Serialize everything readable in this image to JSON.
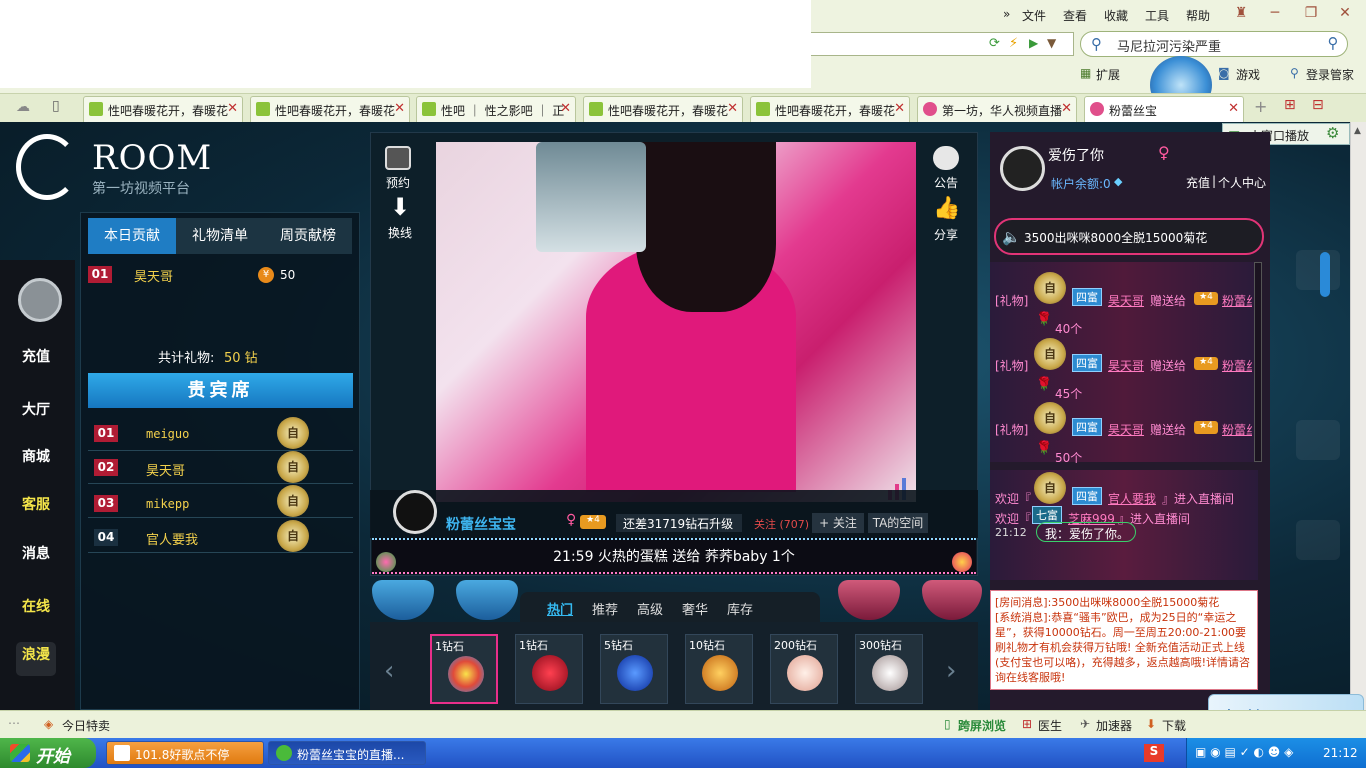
{
  "browser": {
    "menu": [
      "文件",
      "查看",
      "收藏",
      "工具",
      "帮助"
    ],
    "search_text": "马尼拉河污染严重",
    "toolbar": [
      "扩展",
      "游戏",
      "登录管家"
    ],
    "tabs": [
      {
        "label": "性吧春暖花开，春暖花"
      },
      {
        "label": "性吧春暖花开，春暖花"
      },
      {
        "label": "性吧 ｜ 性之影吧 ｜ 正"
      },
      {
        "label": "性吧春暖花开，春暖花"
      },
      {
        "label": "性吧春暖花开，春暖花"
      },
      {
        "label": "第一坊，华人视频直播"
      },
      {
        "label": "粉蕾丝宝"
      }
    ],
    "float_btn": "小窗口播放"
  },
  "site": {
    "brand": "ROOM",
    "brand_sub": "第一坊视频平台"
  },
  "leftnav": [
    "充值",
    "大厅",
    "商城",
    "客服",
    "消息",
    "在线",
    "浪漫"
  ],
  "rank": {
    "tabs": [
      "本日贡献",
      "礼物清单",
      "周贡献榜"
    ],
    "today": [
      {
        "no": "01",
        "name": "昊天哥",
        "amount": "50"
      }
    ],
    "total_label": "共计礼物:",
    "total_value": "50 钻",
    "vip_title": "贵宾席",
    "vip": [
      {
        "no": "01",
        "name": "meiguo"
      },
      {
        "no": "02",
        "name": "昊天哥"
      },
      {
        "no": "03",
        "name": "mikepp"
      },
      {
        "no": "04",
        "name": "官人要我"
      }
    ],
    "shield_label": "自"
  },
  "center": {
    "left_btns": [
      "预约",
      "换线"
    ],
    "right_btns": [
      "公告",
      "分享"
    ],
    "host_name": "粉蕾丝宝宝",
    "upgrade": "还差31719钻石升级",
    "follow_count": "关注 (707)",
    "follow_btn": "+ 关注",
    "space_btn": "TA的空间",
    "ticker": "21:59  火热的蛋糕 送给 荞荞baby  1个"
  },
  "gifts": {
    "tabs": [
      "热门",
      "推荐",
      "高级",
      "奢华",
      "库存"
    ],
    "items": [
      {
        "price": "1钻石",
        "color": "#f0a020"
      },
      {
        "price": "1钻石",
        "color": "#d01830"
      },
      {
        "price": "5钻石",
        "color": "#1f5fd8"
      },
      {
        "price": "10钻石",
        "color": "#e39a20"
      },
      {
        "price": "200钻石",
        "color": "#f4d0c0"
      },
      {
        "price": "300钻石",
        "color": "#f0e4e8"
      }
    ]
  },
  "right": {
    "user_name": "爱伤了你",
    "balance": "帐户余额:0",
    "recharge": "充值",
    "profile": "个人中心",
    "notice": "3500出咪咪8000全脱15000菊花",
    "gift_lines": [
      {
        "tag": "[礼物]",
        "level": "四富",
        "from": "昊天哥",
        "verb": "赠送给",
        "to": "粉蕾丝宝宝",
        "count": "40个"
      },
      {
        "tag": "[礼物]",
        "level": "四富",
        "from": "昊天哥",
        "verb": "赠送给",
        "to": "粉蕾丝宝宝",
        "count": "45个"
      },
      {
        "tag": "[礼物]",
        "level": "四富",
        "from": "昊天哥",
        "verb": "赠送给",
        "to": "粉蕾丝宝宝",
        "count": "50个"
      }
    ],
    "welcome": [
      {
        "pre": "欢迎『",
        "level": "四富",
        "name": "官人要我",
        "post": "』进入直播间"
      },
      {
        "pre": "欢迎『",
        "level": "七富",
        "name": "芝麻999",
        "post": "』进入直播间"
      }
    ],
    "chat_time": "21:12",
    "chat_msg": "我：爱伤了你。",
    "system_msg": "[房间消息]:3500出咪咪8000全脱15000菊花\n[系统消息]:恭喜“骚韦”欧巴，成为25日的“幸运之星”，获得10000钻石。周一至周五20:00-21:00要刷礼物才有机会获得万钻哦! 全新充值活动正式上线(支付宝也可以咯)，充得越多，返点越高哦!详情请咨询在线客服哦!"
  },
  "status": {
    "left": "今日特卖",
    "items": [
      "跨屏浏览",
      "医生",
      "加速器",
      "下载"
    ]
  },
  "taskbar": {
    "start": "开始",
    "tasks": [
      "101.8好歌点不停",
      "粉蕾丝宝宝的直播..."
    ],
    "time": "21:12"
  }
}
